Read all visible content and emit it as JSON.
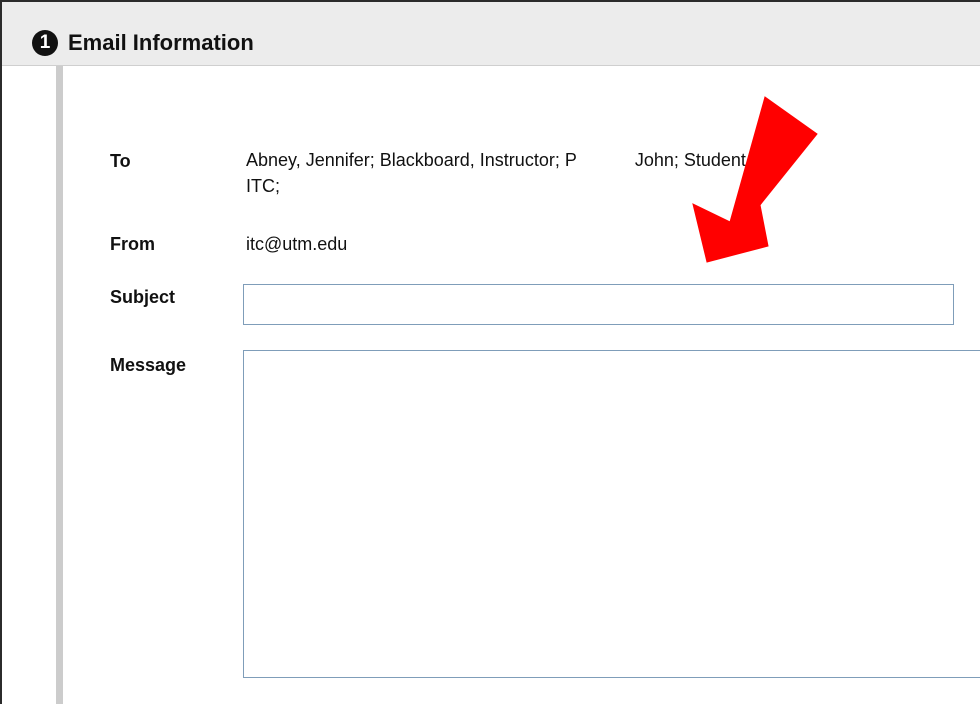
{
  "section": {
    "step_number": "1",
    "title": "Email Information"
  },
  "fields": {
    "to_label": "To",
    "to_value_line1": "Abney, Jennifer; Blackboard, Instructor; P",
    "to_value_hidden_fragment": "John; Student,",
    "to_value_line2": "ITC;",
    "from_label": "From",
    "from_value": "itc@utm.edu",
    "subject_label": "Subject",
    "subject_value": "",
    "message_label": "Message",
    "message_value": ""
  },
  "annotation": {
    "arrow_color": "#ff0000",
    "arrow_icon": "red-arrow-pointing-down-left"
  }
}
